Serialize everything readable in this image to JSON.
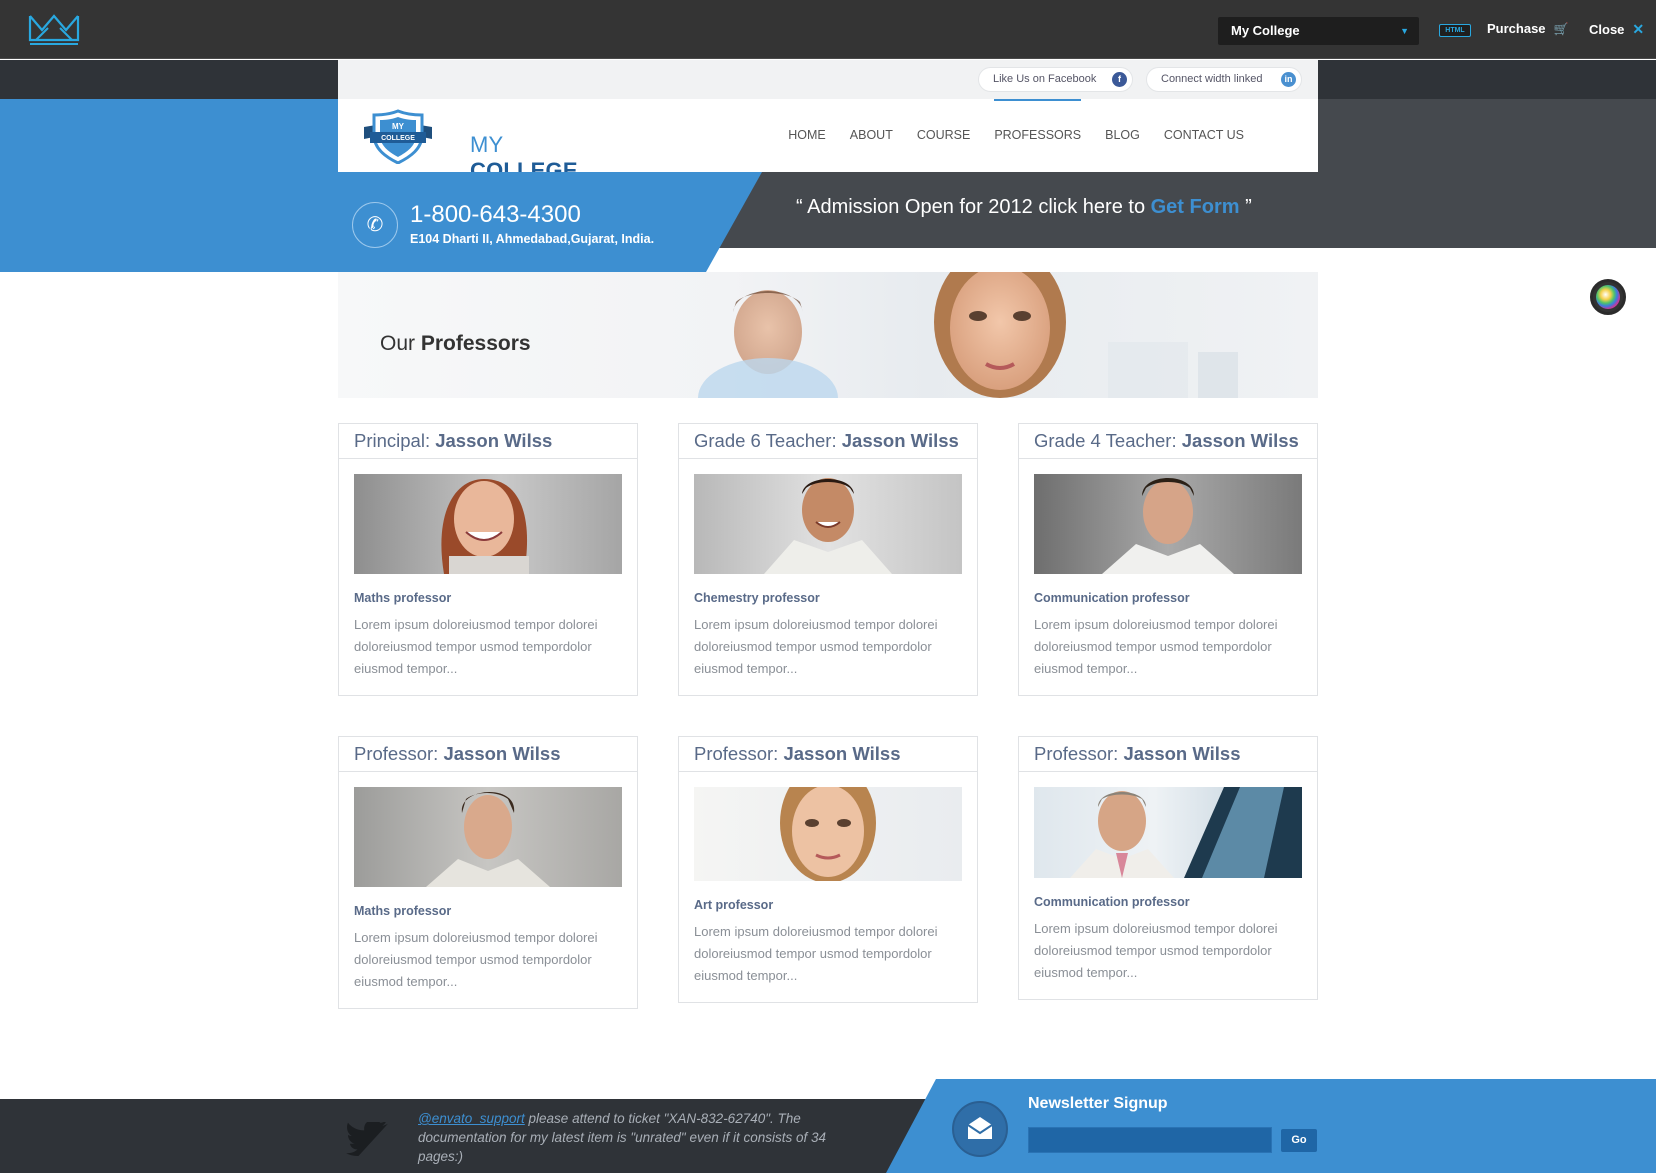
{
  "demo_bar": {
    "theme_select": "My College",
    "html_badge": "HTML",
    "purchase_label": "Purchase",
    "close_label": "Close"
  },
  "topbar": {
    "facebook_label": "Like Us on Facebook",
    "facebook_icon": "f",
    "linkedin_label": "Connect width linked",
    "linkedin_icon": "in"
  },
  "brand": {
    "logo_text_top": "MY",
    "logo_text_bottom": "COLLEGE",
    "name_first": "MY",
    "name_second": "COLLEGE"
  },
  "nav": {
    "items": [
      {
        "label": "HOME"
      },
      {
        "label": "ABOUT"
      },
      {
        "label": "COURSE"
      },
      {
        "label": "PROFESSORS"
      },
      {
        "label": "BLOG"
      },
      {
        "label": "CONTACT US"
      }
    ],
    "active": "PROFESSORS"
  },
  "contact": {
    "phone": "1-800-643-4300",
    "address": "E104 Dharti II, Ahmedabad,Gujarat, India."
  },
  "admission": {
    "open_quote": "“ Admission Open for 2012 click here to ",
    "link": "Get Form",
    "close_quote": " ”"
  },
  "page": {
    "title_prefix": "Our",
    "title_bold": "Professors"
  },
  "professors": [
    {
      "role": "Principal:",
      "name": "Jasson Wilss",
      "subject": "Maths professor",
      "text": "Lorem ipsum doloreiusmod tempor dolorei doloreiusmod tempor usmod tempordolor eiusmod tempor..."
    },
    {
      "role": "Grade 6 Teacher:",
      "name": "Jasson Wilss",
      "subject": "Chemestry professor",
      "text": "Lorem ipsum doloreiusmod tempor dolorei doloreiusmod tempor usmod tempordolor eiusmod tempor..."
    },
    {
      "role": "Grade 4 Teacher:",
      "name": "Jasson Wilss",
      "subject": "Communication professor",
      "text": "Lorem ipsum doloreiusmod tempor dolorei doloreiusmod tempor usmod tempordolor eiusmod tempor..."
    },
    {
      "role": "Professor:",
      "name": "Jasson Wilss",
      "subject": "Maths professor",
      "text": "Lorem ipsum doloreiusmod tempor dolorei doloreiusmod tempor usmod tempordolor eiusmod tempor..."
    },
    {
      "role": "Professor:",
      "name": "Jasson Wilss",
      "subject": "Art professor",
      "text": "Lorem ipsum doloreiusmod tempor dolorei doloreiusmod tempor usmod tempordolor eiusmod tempor..."
    },
    {
      "role": "Professor:",
      "name": "Jasson Wilss",
      "subject": "Communication professor",
      "text": "Lorem ipsum doloreiusmod tempor dolorei doloreiusmod tempor usmod tempordolor eiusmod tempor..."
    }
  ],
  "footer": {
    "tweet_handle": "@envato_support",
    "tweet_text": " please attend to ticket \"XAN-832-62740\". The documentation for my latest item is \"unrated\" even if it consists of 34 pages:)",
    "newsletter_title": "Newsletter Signup",
    "newsletter_go": "Go"
  },
  "colors": {
    "accent_blue": "#3d8fd1",
    "dark_band": "#2f3338",
    "grey_band": "#45494e",
    "heading_slate": "#596a88"
  },
  "icons": [
    "crown-logo-icon",
    "cart-icon",
    "close-icon",
    "facebook-icon",
    "linkedin-icon",
    "phone-icon",
    "twitter-icon",
    "envelope-icon",
    "color-picker-icon"
  ]
}
